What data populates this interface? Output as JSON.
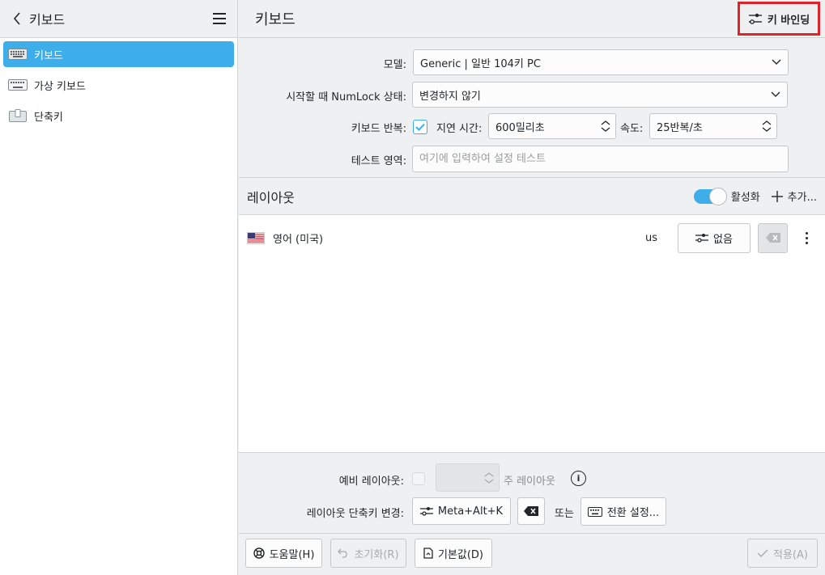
{
  "sidebar": {
    "title": "키보드",
    "items": [
      {
        "label": "키보드",
        "active": true,
        "icon": "keyboard-icon"
      },
      {
        "label": "가상 키보드",
        "active": false,
        "icon": "virtual-keyboard-icon"
      },
      {
        "label": "단축키",
        "active": false,
        "icon": "shortcuts-icon"
      }
    ]
  },
  "header": {
    "title": "키보드",
    "key_bindings_label": "키 바인딩"
  },
  "form": {
    "model_label": "모델:",
    "model_value": "Generic | 일반 104키 PC",
    "numlock_label": "시작할 때 NumLock 상태:",
    "numlock_value": "변경하지 않기",
    "repeat_label": "키보드 반복:",
    "delay_label": "지연 시간:",
    "delay_value": "600밀리초",
    "speed_label": "속도:",
    "speed_value": "25반복/초",
    "test_label": "테스트 영역:",
    "test_placeholder": "여기에 입력하여 설정 테스트"
  },
  "layouts": {
    "title": "레이아웃",
    "enable_label": "활성화",
    "add_label": "추가...",
    "rows": [
      {
        "name": "영어 (미국)",
        "code": "us",
        "shortcut": "없음"
      }
    ]
  },
  "bottom": {
    "spare_label": "예비 레이아웃:",
    "main_layout_label": "주 레이아웃",
    "switch_label": "레이아웃 단축키 변경:",
    "switch_value": "Meta+Alt+K",
    "or_label": "또는",
    "switch_settings_label": "전환 설정..."
  },
  "footer": {
    "help_label": "도움말(H)",
    "reset_label": "초기화(R)",
    "defaults_label": "기본값(D)",
    "apply_label": "적용(A)"
  },
  "colors": {
    "accent": "#3daee9",
    "highlight_frame": "#e0222b"
  }
}
